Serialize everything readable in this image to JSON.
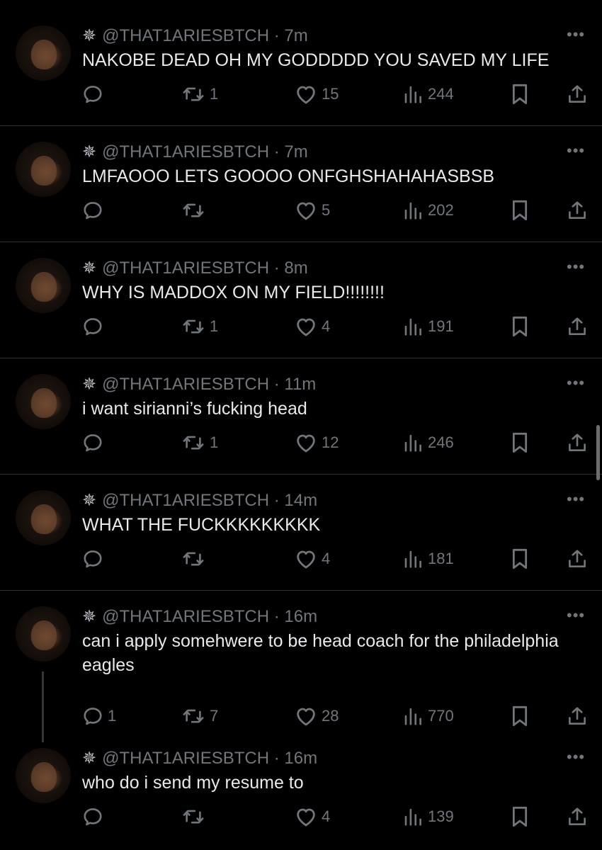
{
  "tweets": [
    {
      "handle": "@THAT1ARIESBTCH",
      "time": "7m",
      "text": "NAKOBE DEAD OH MY GODDDDD YOU SAVED MY LIFE",
      "replies": "",
      "retweets": "1",
      "likes": "15",
      "views": "244"
    },
    {
      "handle": "@THAT1ARIESBTCH",
      "time": "7m",
      "text": "LMFAOOO LETS GOOOO ONFGHSHAHAHASBSB",
      "replies": "",
      "retweets": "",
      "likes": "5",
      "views": "202"
    },
    {
      "handle": "@THAT1ARIESBTCH",
      "time": "8m",
      "text": "WHY IS MADDOX ON MY FIELD!!!!!!!!",
      "replies": "",
      "retweets": "1",
      "likes": "4",
      "views": "191"
    },
    {
      "handle": "@THAT1ARIESBTCH",
      "time": "11m",
      "text": "i want sirianni’s fucking head",
      "replies": "",
      "retweets": "1",
      "likes": "12",
      "views": "246"
    },
    {
      "handle": "@THAT1ARIESBTCH",
      "time": "14m",
      "text": "WHAT THE FUCKKKKKKKKK",
      "replies": "",
      "retweets": "",
      "likes": "4",
      "views": "181"
    },
    {
      "handle": "@THAT1ARIESBTCH",
      "time": "16m",
      "text": "can i apply somehwere to be head coach for the philadelphia eagles",
      "replies": "1",
      "retweets": "7",
      "likes": "28",
      "views": "770"
    },
    {
      "handle": "@THAT1ARIESBTCH",
      "time": "16m",
      "text": "who do i send my resume to",
      "replies": "",
      "retweets": "",
      "likes": "4",
      "views": "139"
    }
  ],
  "ui": {
    "separator": " · ",
    "more_label": "•••",
    "spark_icon": "✵"
  },
  "icons": {
    "reply": "reply-icon",
    "retweet": "retweet-icon",
    "like": "heart-icon",
    "views": "views-icon",
    "bookmark": "bookmark-icon",
    "share": "share-icon",
    "avatar": "avatar"
  },
  "colors": {
    "background": "#000000",
    "text": "#e7e9ea",
    "muted": "#71767b",
    "divider": "#2f3336"
  }
}
